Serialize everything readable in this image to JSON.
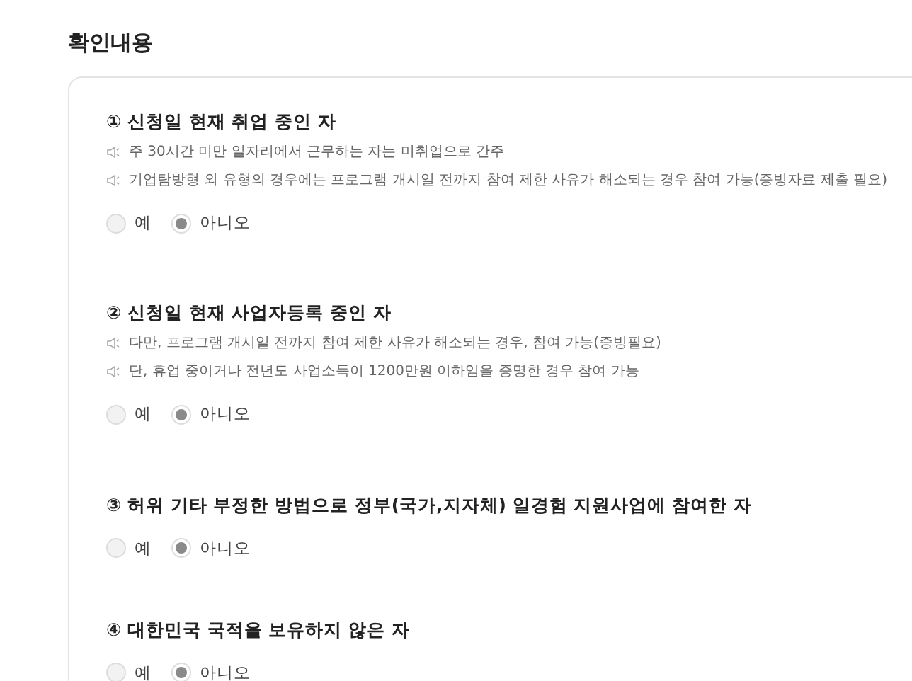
{
  "heading": "확인내용",
  "items": [
    {
      "title": "① 신청일 현재 취업 중인 자",
      "notes": [
        "주 30시간 미만 일자리에서 근무하는 자는 미취업으로 간주",
        "기업탐방형 외 유형의 경우에는 프로그램 개시일 전까지 참여 제한 사유가 해소되는 경우 참여 가능(증빙자료 제출 필요)"
      ],
      "options": [
        {
          "label": "예",
          "selected": false
        },
        {
          "label": "아니오",
          "selected": true
        }
      ]
    },
    {
      "title": "② 신청일 현재 사업자등록 중인 자",
      "notes": [
        "다만, 프로그램 개시일 전까지 참여 제한 사유가 해소되는 경우, 참여 가능(증빙필요)",
        "단, 휴업 중이거나 전년도 사업소득이 1200만원 이하임을 증명한 경우 참여 가능"
      ],
      "options": [
        {
          "label": "예",
          "selected": false
        },
        {
          "label": "아니오",
          "selected": true
        }
      ]
    },
    {
      "title": "③ 허위 기타 부정한 방법으로 정부(국가,지자체) 일경험 지원사업에 참여한 자",
      "options": [
        {
          "label": "예",
          "selected": false
        },
        {
          "label": "아니오",
          "selected": true
        }
      ]
    },
    {
      "title": "④ 대한민국 국적을 보유하지 않은 자",
      "options": [
        {
          "label": "예",
          "selected": false
        },
        {
          "label": "아니오",
          "selected": true
        }
      ]
    }
  ]
}
